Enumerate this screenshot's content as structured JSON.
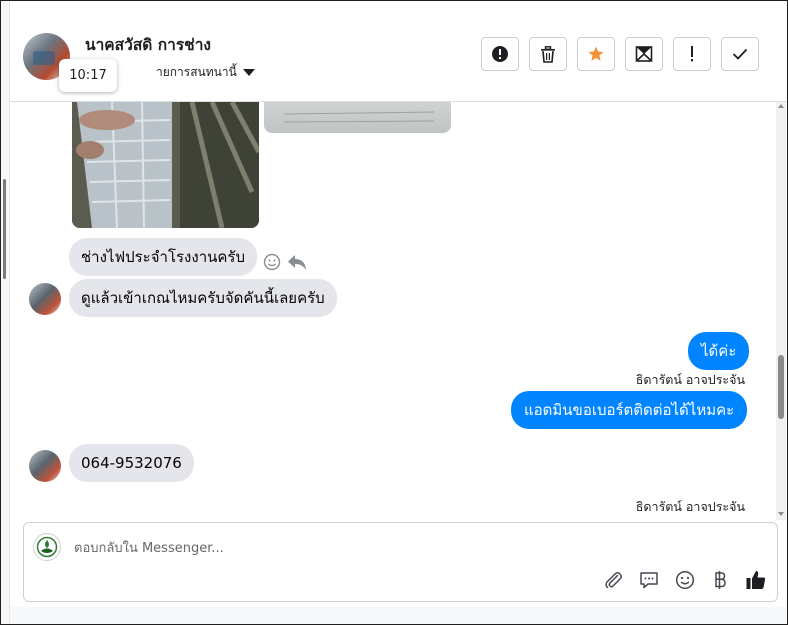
{
  "header": {
    "contact_name": "นาคสวัสดิ การช่าง",
    "assign_label": "ายการสนทนานี้",
    "tooltip_time": "10:17"
  },
  "toolbar": [
    {
      "id": "report",
      "icon": "alert-circle-icon"
    },
    {
      "id": "delete",
      "icon": "trash-icon"
    },
    {
      "id": "star",
      "icon": "star-icon",
      "color": "#f7923a"
    },
    {
      "id": "mark-unread",
      "icon": "envelope-icon"
    },
    {
      "id": "spam",
      "icon": "exclamation-icon"
    },
    {
      "id": "done",
      "icon": "checkmark-icon"
    }
  ],
  "messages": [
    {
      "side": "in",
      "text": "ช่างไฟประจำโรงงานครับ"
    },
    {
      "side": "in",
      "text": "ดูแล้วเข้าเกณไหมครับจัดคันนี้เลยครับ"
    },
    {
      "side": "out",
      "text": "ได้ค่ะ"
    },
    {
      "side": "out",
      "sender": "ธิดารัตน์ อาจประจัน",
      "text": "แอดมินขอเบอร์ตติดต่อได้ไหมคะ"
    },
    {
      "side": "in",
      "text": "064-9532076"
    },
    {
      "side": "out",
      "sender": "ธิดารัตน์ อาจประจัน"
    }
  ],
  "composer": {
    "placeholder": "ตอบกลับใน Messenger...",
    "value": ""
  },
  "colors": {
    "outgoing_bubble": "#0084ff",
    "incoming_bubble": "#e4e6eb",
    "star": "#f7923a"
  }
}
